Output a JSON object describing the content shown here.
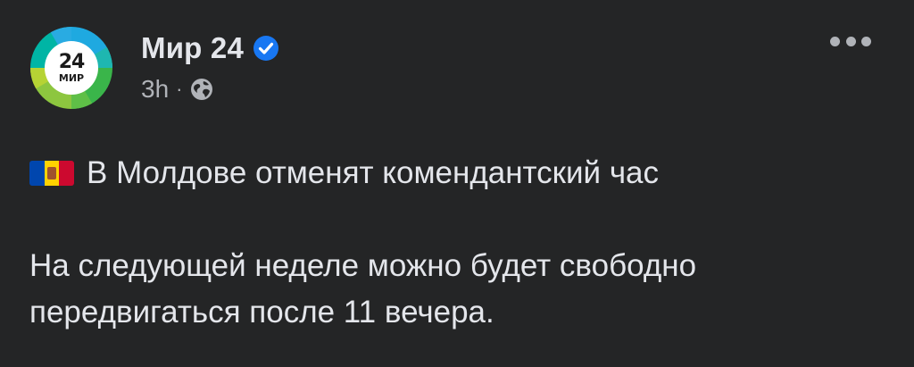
{
  "post": {
    "page_name": "Мир 24",
    "avatar": {
      "number": "24",
      "word": "МИР"
    },
    "time": "3h",
    "separator": "·",
    "icons": {
      "verified": "verified-badge-icon",
      "audience": "globe-icon",
      "menu": "more-options-icon",
      "flag": "moldova-flag-icon"
    },
    "headline": "В Молдове отменят комендантский час",
    "body_line_1": "На следующей неделе можно будет свободно",
    "body_line_2": "передвигаться после 11 вечера.",
    "colors": {
      "background": "#242526",
      "text": "#e4e6eb",
      "secondary_text": "#b0b3b8",
      "verified": "#1877f2"
    }
  }
}
